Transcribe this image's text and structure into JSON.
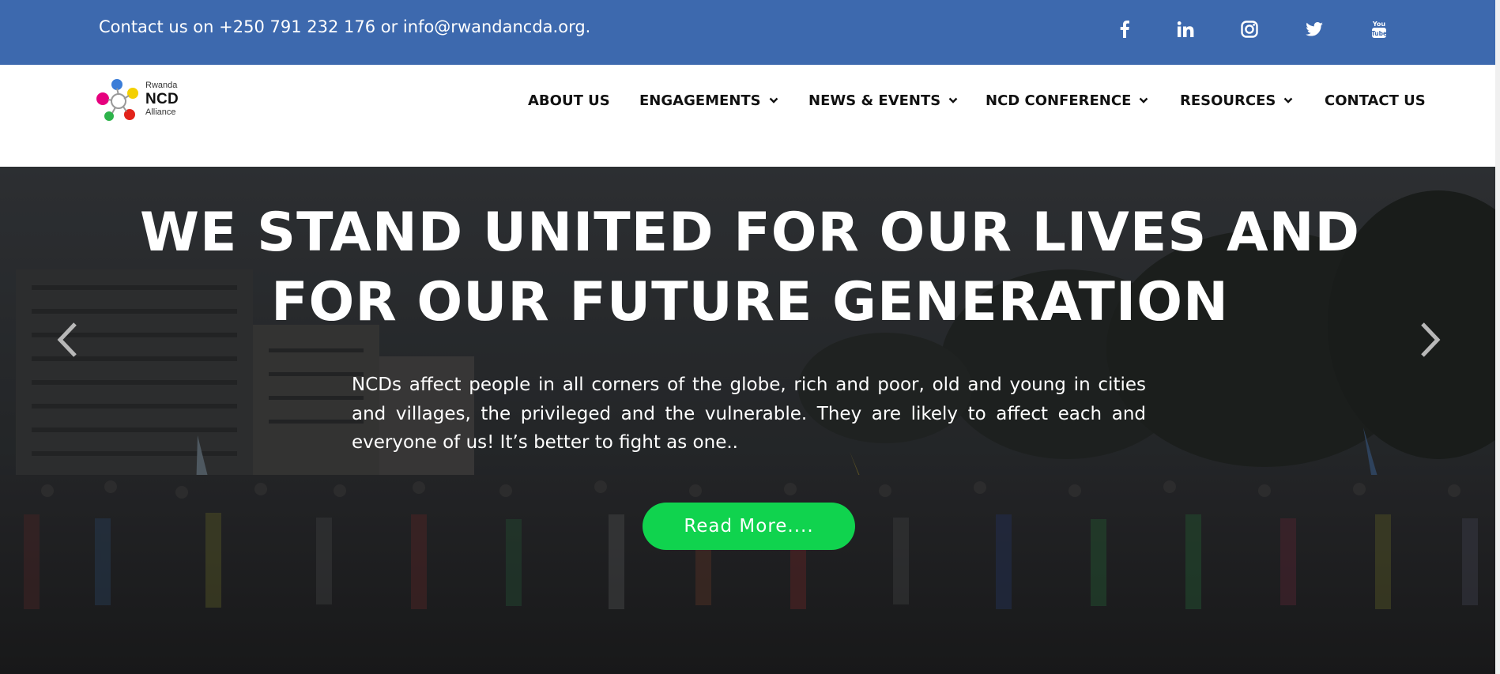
{
  "topbar": {
    "contact_text": "Contact us on +250 791 232 176 or info@rwandancda.org.",
    "background": "#3d69ae",
    "social": [
      {
        "icon": "facebook-icon"
      },
      {
        "icon": "linkedin-icon"
      },
      {
        "icon": "instagram-icon"
      },
      {
        "icon": "twitter-icon"
      },
      {
        "icon": "youtube-icon"
      }
    ]
  },
  "logo": {
    "line1": "Rwanda",
    "line2": "NCD",
    "line3": "Alliance",
    "colors": [
      "#3b7dd8",
      "#f4d000",
      "#e6007e",
      "#e2231a",
      "#2db34a"
    ]
  },
  "nav": {
    "items": [
      {
        "label": "ABOUT US",
        "dropdown": false
      },
      {
        "label": "ENGAGEMENTS",
        "dropdown": true
      },
      {
        "label": "NEWS & EVENTS",
        "dropdown": true
      },
      {
        "label": "NCD CONFERENCE",
        "dropdown": true
      },
      {
        "label": "RESOURCES",
        "dropdown": true
      },
      {
        "label": "CONTACT US",
        "dropdown": false
      }
    ]
  },
  "hero": {
    "title_line1": "WE STAND UNITED FOR OUR LIVES AND",
    "title_line2": "FOR OUR FUTURE GENERATION",
    "text": "NCDs affect people in all corners of the globe, rich and poor, old and young in cities and villages, the privileged and the vulnerable. They are likely to affect each and everyone of us! It’s better to fight as one..",
    "button_label": "Read More....",
    "button_color": "#10d34e",
    "prev_icon": "chevron-left-icon",
    "next_icon": "chevron-right-icon"
  }
}
